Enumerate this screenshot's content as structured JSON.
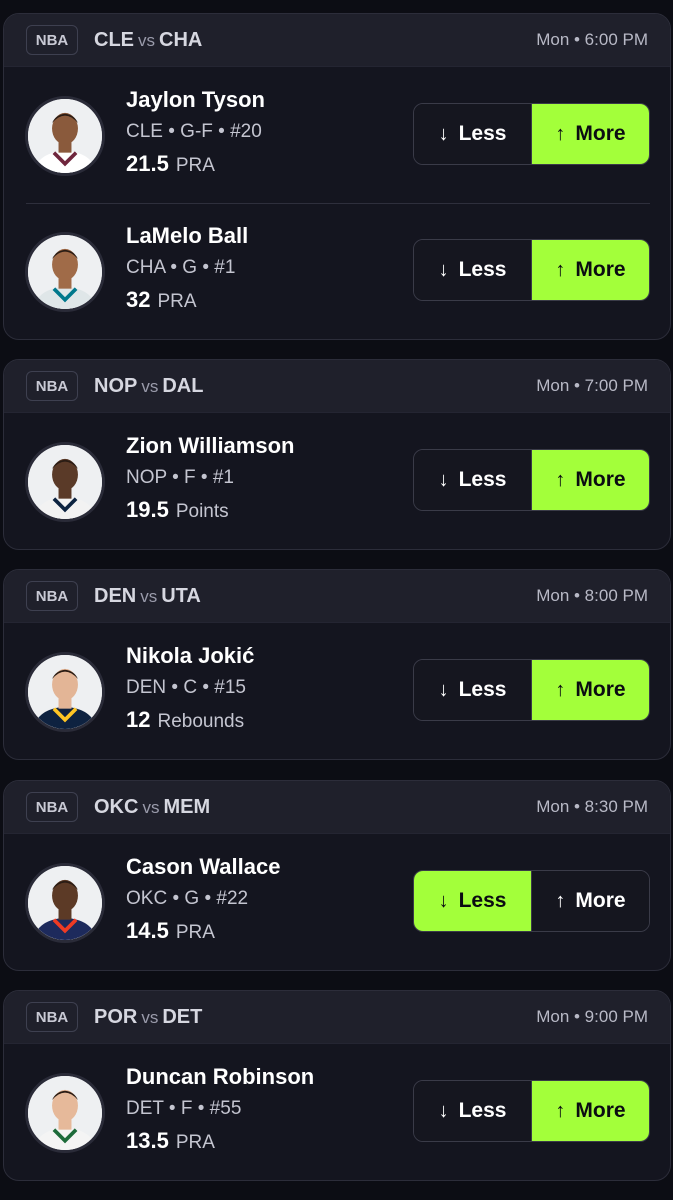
{
  "colors": {
    "accent": "#a3ff3a",
    "background": "#0c0d14",
    "card": "#14151f",
    "header": "#1f202b"
  },
  "pick_labels": {
    "less": "Less",
    "more": "More",
    "less_icon": "arrow-down-icon",
    "more_icon": "arrow-up-icon"
  },
  "cards": [
    {
      "league": "NBA",
      "home": "CLE",
      "vs": "vs",
      "away": "CHA",
      "time": "Mon • 6:00 PM",
      "players": [
        {
          "name": "Jaylon Tyson",
          "meta": "CLE • G-F • #20",
          "line": "21.5",
          "stat": "PRA",
          "selected": "more",
          "jersey": "#ffffff",
          "trim": "#6f263d",
          "skin": "#8a5a3c"
        },
        {
          "name": "LaMelo Ball",
          "meta": "CHA • G • #1",
          "line": "32",
          "stat": "PRA",
          "selected": "more",
          "jersey": "#dfe6e8",
          "trim": "#00788c",
          "skin": "#a06b48"
        }
      ]
    },
    {
      "league": "NBA",
      "home": "NOP",
      "vs": "vs",
      "away": "DAL",
      "time": "Mon • 7:00 PM",
      "players": [
        {
          "name": "Zion Williamson",
          "meta": "NOP • F • #1",
          "line": "19.5",
          "stat": "Points",
          "selected": "more",
          "jersey": "#f2f2f2",
          "trim": "#0c2340",
          "skin": "#5a3a28"
        }
      ]
    },
    {
      "league": "NBA",
      "home": "DEN",
      "vs": "vs",
      "away": "UTA",
      "time": "Mon • 8:00 PM",
      "players": [
        {
          "name": "Nikola Jokić",
          "meta": "DEN • C • #15",
          "line": "12",
          "stat": "Rebounds",
          "selected": "more",
          "jersey": "#0e2240",
          "trim": "#fec524",
          "skin": "#e3b596"
        }
      ]
    },
    {
      "league": "NBA",
      "home": "OKC",
      "vs": "vs",
      "away": "MEM",
      "time": "Mon • 8:30 PM",
      "players": [
        {
          "name": "Cason Wallace",
          "meta": "OKC • G • #22",
          "line": "14.5",
          "stat": "PRA",
          "selected": "less",
          "jersey": "#1d2a5c",
          "trim": "#ef3b24",
          "skin": "#5c3a26"
        }
      ]
    },
    {
      "league": "NBA",
      "home": "POR",
      "vs": "vs",
      "away": "DET",
      "time": "Mon • 9:00 PM",
      "players": [
        {
          "name": "Duncan Robinson",
          "meta": "DET • F • #55",
          "line": "13.5",
          "stat": "PRA",
          "selected": "more",
          "jersey": "#f4f4f4",
          "trim": "#1d6b3a",
          "skin": "#e6b99a"
        }
      ]
    }
  ]
}
